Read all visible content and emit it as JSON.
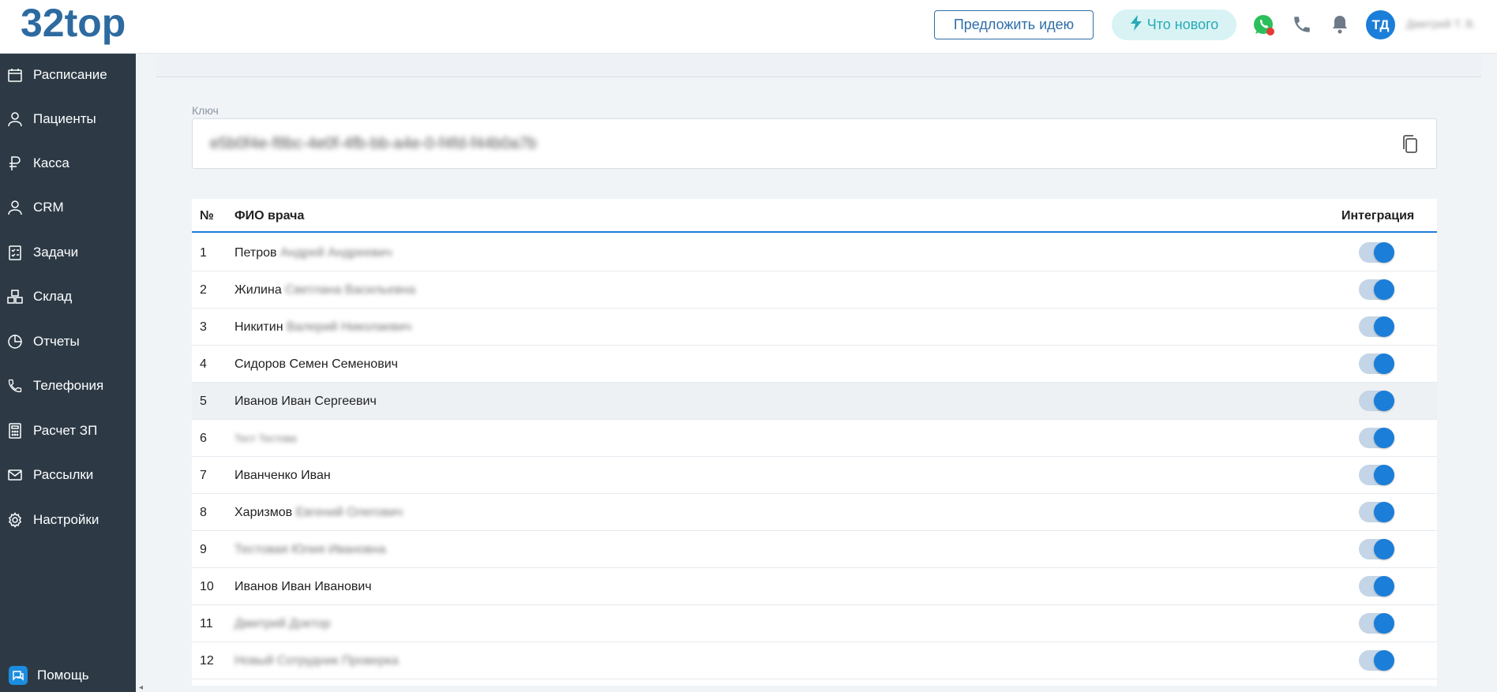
{
  "header": {
    "logo": "32top",
    "suggest_idea": "Предложить идею",
    "whats_new": "Что нового",
    "avatar_initials": "ТД",
    "user_name": "Дмитрий Т. В."
  },
  "sidebar": {
    "items": [
      {
        "label": "Расписание",
        "icon": "calendar-icon"
      },
      {
        "label": "Пациенты",
        "icon": "user-icon"
      },
      {
        "label": "Касса",
        "icon": "ruble-icon"
      },
      {
        "label": "CRM",
        "icon": "user-icon"
      },
      {
        "label": "Задачи",
        "icon": "checklist-icon"
      },
      {
        "label": "Склад",
        "icon": "boxes-icon"
      },
      {
        "label": "Отчеты",
        "icon": "pie-chart-icon"
      },
      {
        "label": "Телефония",
        "icon": "phone-icon"
      },
      {
        "label": "Расчет ЗП",
        "icon": "calculator-icon"
      },
      {
        "label": "Рассылки",
        "icon": "mail-icon"
      },
      {
        "label": "Настройки",
        "icon": "gear-icon"
      }
    ],
    "help": "Помощь"
  },
  "key": {
    "label": "Ключ",
    "value": "e5b0f4e-f8bc-4e0f-4fb-bb-a4e-0-f4fd-f44b0a7b"
  },
  "table": {
    "headers": {
      "num": "№",
      "name": "ФИО врача",
      "integration": "Интеграция"
    },
    "rows": [
      {
        "num": "1",
        "name": "Петров",
        "hidden": "Андрей Андреевич",
        "integration": true
      },
      {
        "num": "2",
        "name": "Жилина",
        "hidden": "Светлана Васильевна",
        "integration": true
      },
      {
        "num": "3",
        "name": "Никитин",
        "hidden": "Валерий Николаевич",
        "integration": true
      },
      {
        "num": "4",
        "name": "Сидоров Семен Семенович",
        "hidden": "",
        "integration": true
      },
      {
        "num": "5",
        "name": "Иванов Иван Сергеевич",
        "hidden": "",
        "integration": true
      },
      {
        "num": "6",
        "name": "",
        "hidden": "Тест Тестова",
        "integration": true
      },
      {
        "num": "7",
        "name": "Иванченко Иван",
        "hidden": "",
        "integration": true
      },
      {
        "num": "8",
        "name": "Харизмов",
        "hidden": "Евгений Олегович",
        "integration": true
      },
      {
        "num": "9",
        "name": "",
        "hidden": "Тестовая Юлия Ивановна",
        "integration": true
      },
      {
        "num": "10",
        "name": "Иванов Иван Иванович",
        "hidden": "",
        "integration": true
      },
      {
        "num": "11",
        "name": "",
        "hidden": "Дмитрий Доктор",
        "integration": true
      },
      {
        "num": "12",
        "name": "",
        "hidden": "Новый Сотрудник Проверка",
        "integration": true
      }
    ]
  },
  "colors": {
    "accent": "#1b7ed8",
    "sidebar_bg": "#2d3a46",
    "logo": "#2d6aa0",
    "whats_new_bg": "#d9f3f5"
  }
}
